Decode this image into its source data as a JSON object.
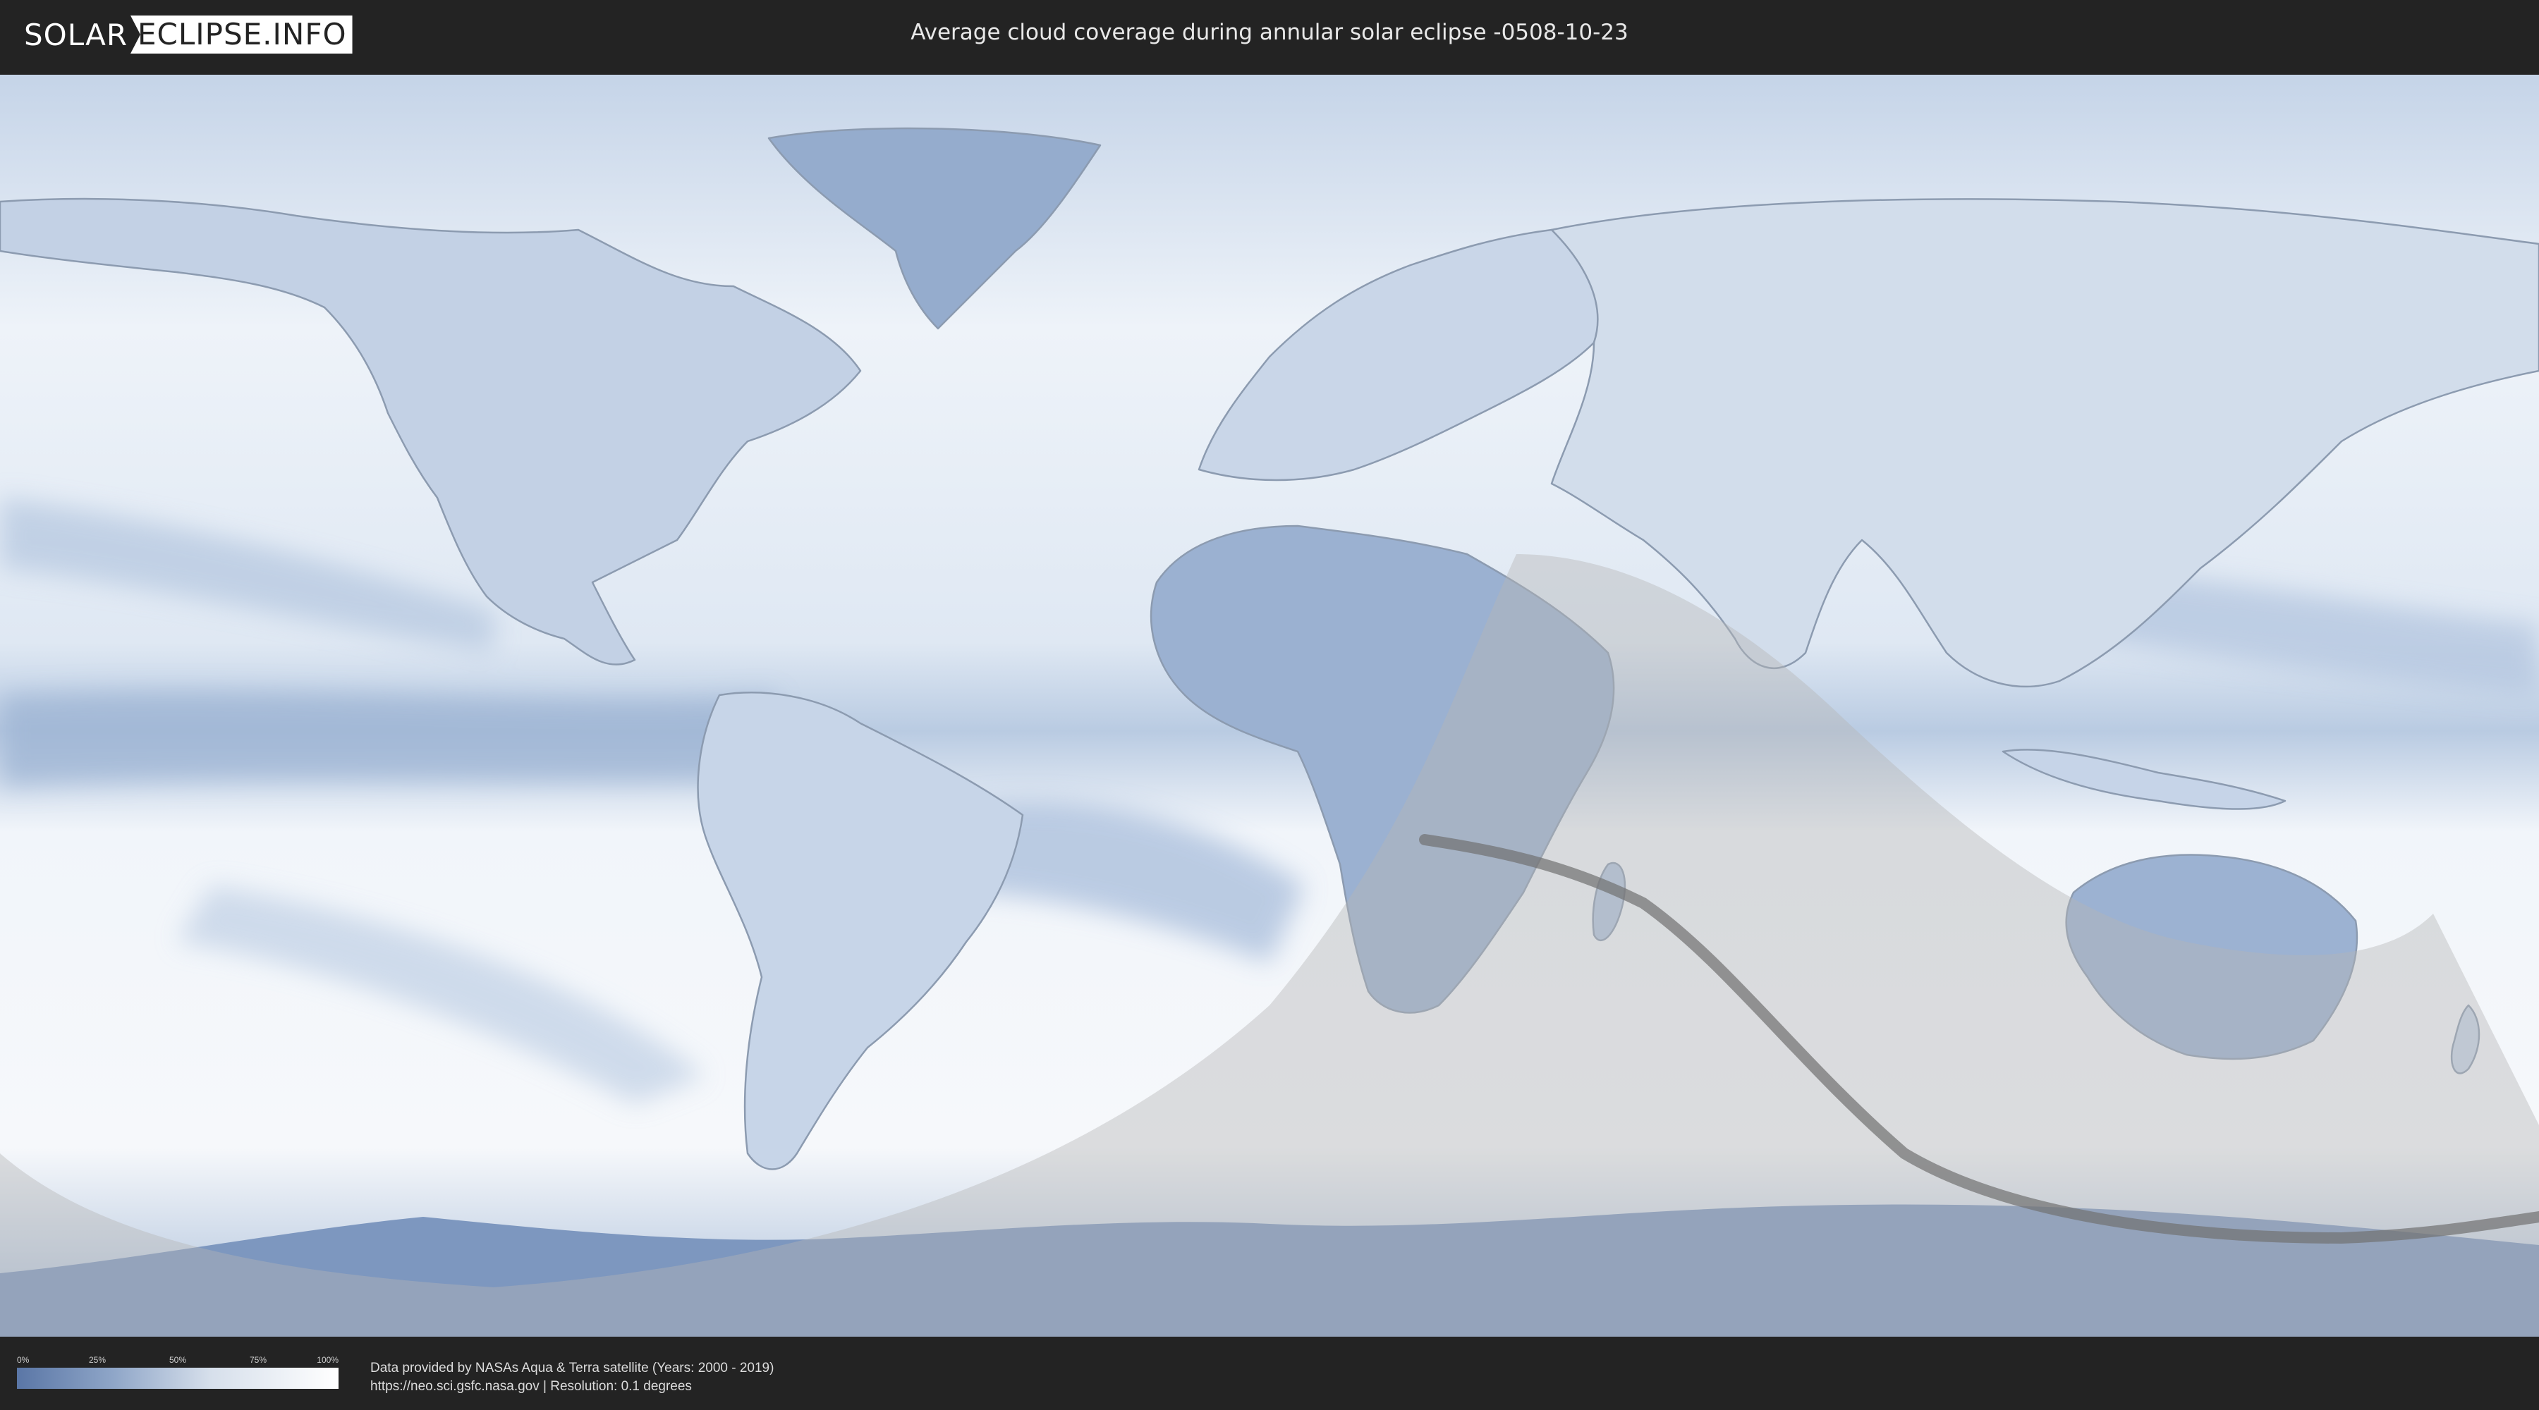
{
  "header": {
    "logo_left": "SOLAR",
    "logo_right": "ECLIPSE.INFO",
    "title": "Average cloud coverage during annular solar eclipse -0508-10-23"
  },
  "legend": {
    "ticks": [
      "0%",
      "25%",
      "50%",
      "75%",
      "100%"
    ],
    "gradient_colors": [
      "#5a76a6",
      "#8fa6c8",
      "#d6dfeb",
      "#ffffff"
    ]
  },
  "footer": {
    "credit_line1": "Data provided by NASAs Aqua & Terra satellite (Years: 2000 - 2019)",
    "credit_line2": "https://neo.sci.gsfc.nasa.gov | Resolution: 0.1 degrees"
  },
  "map": {
    "projection": "equirectangular",
    "layer": "average cloud coverage",
    "colors": {
      "clear_sky": "#5a76a6",
      "cloudy": "#ffffff",
      "land_outline": "#8c9bb0",
      "eclipse_shade": "#b4b4b4",
      "central_line": "#707070"
    }
  }
}
